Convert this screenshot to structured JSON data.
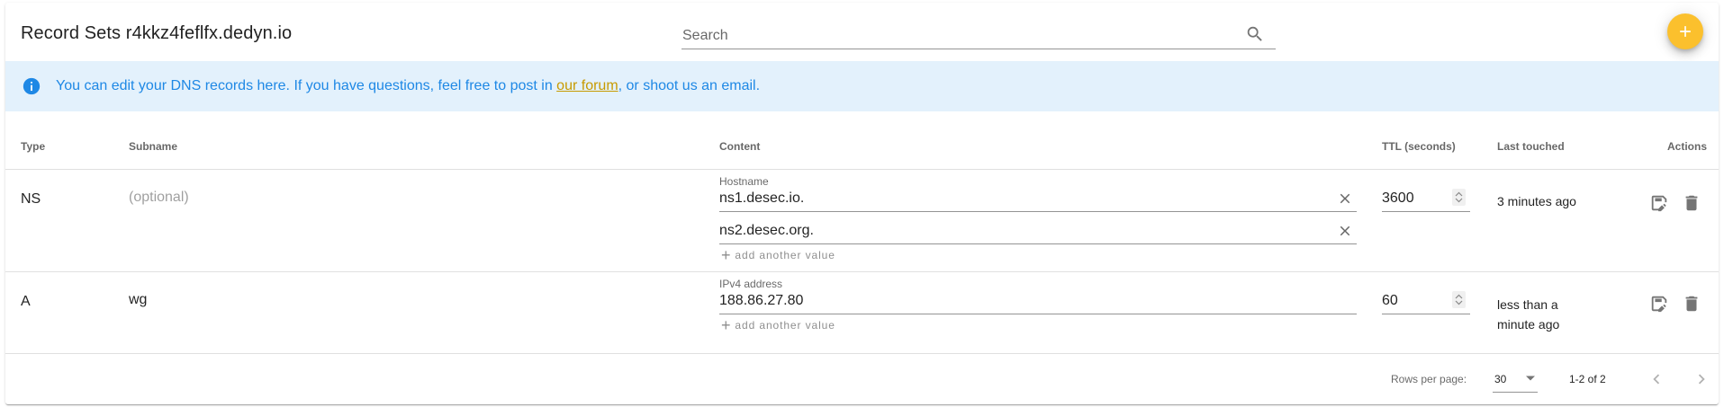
{
  "toolbar": {
    "title": "Record Sets r4kkz4feflfx.dedyn.io",
    "search_placeholder": "Search",
    "add_icon": "plus-icon",
    "accent_color": "#fbc02d"
  },
  "alert": {
    "icon": "info-icon",
    "text_before": "You can edit your DNS records here. If you have questions, feel free to post in ",
    "link_text": "our forum",
    "text_after": ", or shoot us an email.",
    "background": "#e3f1fc",
    "text_color": "#1e88e5"
  },
  "table": {
    "headers": {
      "type": "Type",
      "subname": "Subname",
      "content": "Content",
      "ttl": "TTL (seconds)",
      "last_touched": "Last touched",
      "actions": "Actions"
    },
    "add_value_label": "add another value",
    "rows": [
      {
        "type": "NS",
        "subname": "",
        "subname_placeholder": "(optional)",
        "content_label": "Hostname",
        "values": [
          "ns1.desec.io.",
          "ns2.desec.org."
        ],
        "ttl": "3600",
        "last_touched": "3 minutes ago"
      },
      {
        "type": "A",
        "subname": "wg",
        "subname_placeholder": "(optional)",
        "content_label": "IPv4 address",
        "values": [
          "188.86.27.80"
        ],
        "ttl": "60",
        "last_touched": "less than a minute ago"
      }
    ]
  },
  "footer": {
    "rows_per_page_label": "Rows per page:",
    "rows_per_page_value": "30",
    "range_text": "1-2 of 2"
  }
}
